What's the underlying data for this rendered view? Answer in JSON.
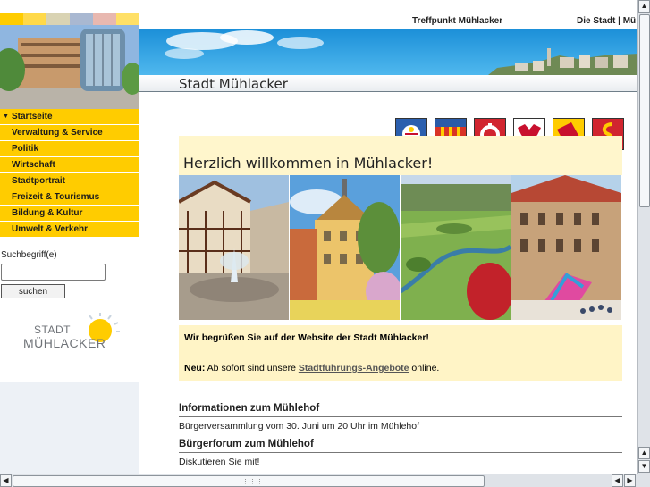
{
  "header": {
    "links": [
      "Treffpunkt Mühlacker",
      "Die Stadt | Mü"
    ],
    "page_title": "Stadt Mühlacker"
  },
  "swatch_colors": [
    "#ffcc00",
    "#ffd94a",
    "#d9d3b3",
    "#a9b8d1",
    "#e8b8b0",
    "#ffe067"
  ],
  "nav": {
    "items": [
      {
        "label": "Startseite",
        "active": true
      },
      {
        "label": "Verwaltung & Service",
        "active": false
      },
      {
        "label": "Politik",
        "active": false
      },
      {
        "label": "Wirtschaft",
        "active": false
      },
      {
        "label": "Stadtportrait",
        "active": false
      },
      {
        "label": "Freizeit & Tourismus",
        "active": false
      },
      {
        "label": "Bildung & Kultur",
        "active": false
      },
      {
        "label": "Umwelt & Verkehr",
        "active": false
      }
    ]
  },
  "search": {
    "label": "Suchbegriff(e)",
    "value": "",
    "button": "suchen"
  },
  "logo": {
    "line1": "STADT",
    "line2": "MÜHLACKER"
  },
  "welcome": {
    "title": "Herzlich willkommen in Mühlacker!"
  },
  "crests": [
    "crest-icon",
    "crest-icon",
    "crest-icon",
    "crest-icon",
    "crest-icon",
    "crest-icon"
  ],
  "infobox": {
    "line1": "Wir begrüßen Sie auf der Website der Stadt Mühlacker!",
    "neu_label": "Neu:",
    "line2_pre": " Ab sofort sind unsere ",
    "line2_link": "Stadtführungs-Angebote",
    "line2_post": " online."
  },
  "news": [
    {
      "heading": "Informationen zum Mühlehof",
      "text": "Bürgerversammlung vom 30. Juni um 20 Uhr im Mühlehof"
    },
    {
      "heading": "Bürgerforum zum Mühlehof",
      "text": "Diskutieren Sie mit!"
    }
  ],
  "colors": {
    "nav_yellow": "#ffcc00",
    "welcome_bg": "#fff6cc",
    "infobox_bg": "#fff4c6",
    "banner_sky": "#2aa4e6"
  }
}
